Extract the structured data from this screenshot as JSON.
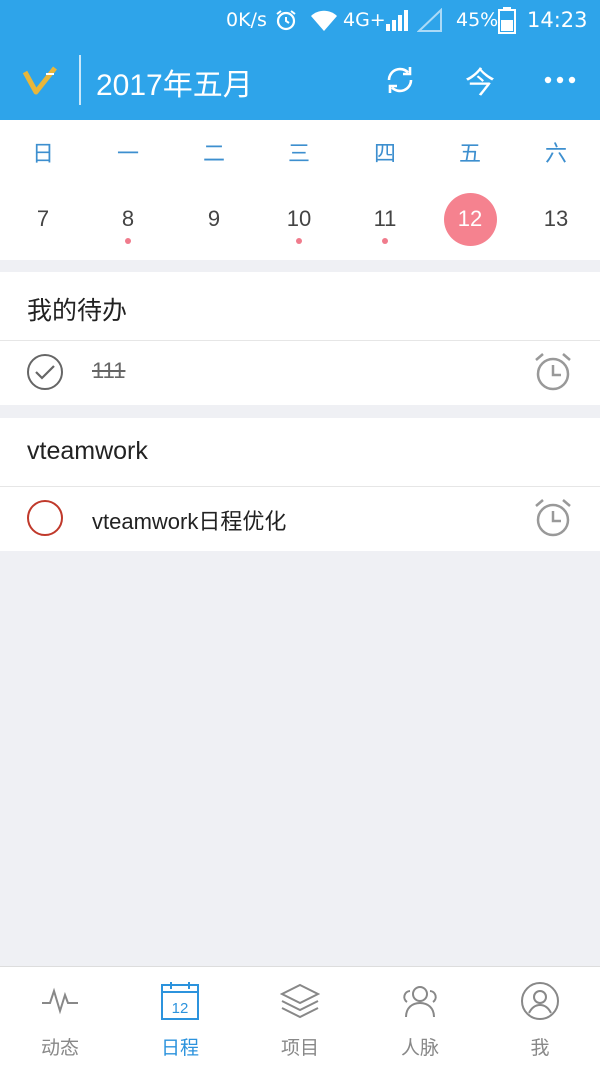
{
  "status_bar": {
    "speed": "0K/s",
    "network": "4G+",
    "battery": "45%",
    "time": "14:23"
  },
  "header": {
    "title": "2017年五月",
    "icons": [
      "logo-v-icon",
      "refresh-icon",
      "today-icon",
      "more-icon"
    ],
    "today_label": "今"
  },
  "calendar": {
    "weekdays": [
      "日",
      "一",
      "二",
      "三",
      "四",
      "五",
      "六"
    ],
    "days": [
      "7",
      "8",
      "9",
      "10",
      "11",
      "12",
      "13"
    ],
    "dots": [
      false,
      true,
      false,
      true,
      true,
      false,
      false
    ],
    "selected_index": 5
  },
  "sections": [
    {
      "title": "我的待办",
      "tasks": [
        {
          "label": "111",
          "done": true
        }
      ]
    },
    {
      "title": "vteamwork",
      "tasks": [
        {
          "label": "vteamwork日程优化",
          "done": false
        }
      ]
    }
  ],
  "nav": {
    "items": [
      {
        "label": "动态",
        "icon": "pulse-icon"
      },
      {
        "label": "日程",
        "icon": "calendar-icon",
        "calendar_day": "12"
      },
      {
        "label": "项目",
        "icon": "layers-icon"
      },
      {
        "label": "人脉",
        "icon": "contacts-icon"
      },
      {
        "label": "我",
        "icon": "profile-icon"
      }
    ],
    "active_index": 1
  },
  "colors": {
    "brand_blue": "#2ea4ea",
    "weekday_blue": "#3d8fcf",
    "selected_pink": "#f5828f",
    "todo_red": "#c0392b"
  }
}
